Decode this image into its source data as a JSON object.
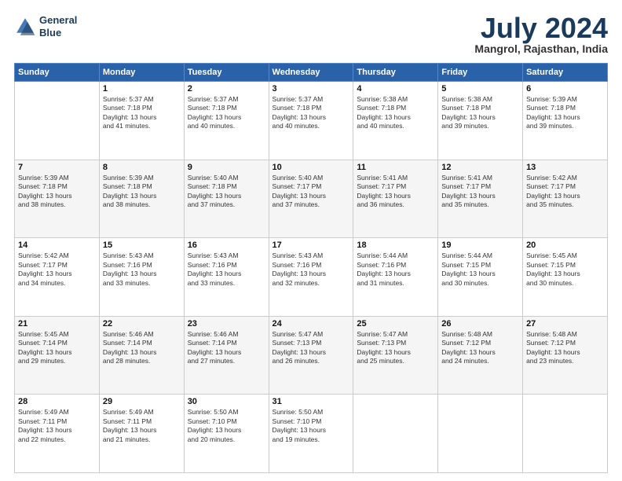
{
  "header": {
    "logo_line1": "General",
    "logo_line2": "Blue",
    "month": "July 2024",
    "location": "Mangrol, Rajasthan, India"
  },
  "days_of_week": [
    "Sunday",
    "Monday",
    "Tuesday",
    "Wednesday",
    "Thursday",
    "Friday",
    "Saturday"
  ],
  "weeks": [
    [
      {
        "day": "",
        "info": ""
      },
      {
        "day": "1",
        "info": "Sunrise: 5:37 AM\nSunset: 7:18 PM\nDaylight: 13 hours\nand 41 minutes."
      },
      {
        "day": "2",
        "info": "Sunrise: 5:37 AM\nSunset: 7:18 PM\nDaylight: 13 hours\nand 40 minutes."
      },
      {
        "day": "3",
        "info": "Sunrise: 5:37 AM\nSunset: 7:18 PM\nDaylight: 13 hours\nand 40 minutes."
      },
      {
        "day": "4",
        "info": "Sunrise: 5:38 AM\nSunset: 7:18 PM\nDaylight: 13 hours\nand 40 minutes."
      },
      {
        "day": "5",
        "info": "Sunrise: 5:38 AM\nSunset: 7:18 PM\nDaylight: 13 hours\nand 39 minutes."
      },
      {
        "day": "6",
        "info": "Sunrise: 5:39 AM\nSunset: 7:18 PM\nDaylight: 13 hours\nand 39 minutes."
      }
    ],
    [
      {
        "day": "7",
        "info": "Sunrise: 5:39 AM\nSunset: 7:18 PM\nDaylight: 13 hours\nand 38 minutes."
      },
      {
        "day": "8",
        "info": "Sunrise: 5:39 AM\nSunset: 7:18 PM\nDaylight: 13 hours\nand 38 minutes."
      },
      {
        "day": "9",
        "info": "Sunrise: 5:40 AM\nSunset: 7:18 PM\nDaylight: 13 hours\nand 37 minutes."
      },
      {
        "day": "10",
        "info": "Sunrise: 5:40 AM\nSunset: 7:17 PM\nDaylight: 13 hours\nand 37 minutes."
      },
      {
        "day": "11",
        "info": "Sunrise: 5:41 AM\nSunset: 7:17 PM\nDaylight: 13 hours\nand 36 minutes."
      },
      {
        "day": "12",
        "info": "Sunrise: 5:41 AM\nSunset: 7:17 PM\nDaylight: 13 hours\nand 35 minutes."
      },
      {
        "day": "13",
        "info": "Sunrise: 5:42 AM\nSunset: 7:17 PM\nDaylight: 13 hours\nand 35 minutes."
      }
    ],
    [
      {
        "day": "14",
        "info": "Sunrise: 5:42 AM\nSunset: 7:17 PM\nDaylight: 13 hours\nand 34 minutes."
      },
      {
        "day": "15",
        "info": "Sunrise: 5:43 AM\nSunset: 7:16 PM\nDaylight: 13 hours\nand 33 minutes."
      },
      {
        "day": "16",
        "info": "Sunrise: 5:43 AM\nSunset: 7:16 PM\nDaylight: 13 hours\nand 33 minutes."
      },
      {
        "day": "17",
        "info": "Sunrise: 5:43 AM\nSunset: 7:16 PM\nDaylight: 13 hours\nand 32 minutes."
      },
      {
        "day": "18",
        "info": "Sunrise: 5:44 AM\nSunset: 7:16 PM\nDaylight: 13 hours\nand 31 minutes."
      },
      {
        "day": "19",
        "info": "Sunrise: 5:44 AM\nSunset: 7:15 PM\nDaylight: 13 hours\nand 30 minutes."
      },
      {
        "day": "20",
        "info": "Sunrise: 5:45 AM\nSunset: 7:15 PM\nDaylight: 13 hours\nand 30 minutes."
      }
    ],
    [
      {
        "day": "21",
        "info": "Sunrise: 5:45 AM\nSunset: 7:14 PM\nDaylight: 13 hours\nand 29 minutes."
      },
      {
        "day": "22",
        "info": "Sunrise: 5:46 AM\nSunset: 7:14 PM\nDaylight: 13 hours\nand 28 minutes."
      },
      {
        "day": "23",
        "info": "Sunrise: 5:46 AM\nSunset: 7:14 PM\nDaylight: 13 hours\nand 27 minutes."
      },
      {
        "day": "24",
        "info": "Sunrise: 5:47 AM\nSunset: 7:13 PM\nDaylight: 13 hours\nand 26 minutes."
      },
      {
        "day": "25",
        "info": "Sunrise: 5:47 AM\nSunset: 7:13 PM\nDaylight: 13 hours\nand 25 minutes."
      },
      {
        "day": "26",
        "info": "Sunrise: 5:48 AM\nSunset: 7:12 PM\nDaylight: 13 hours\nand 24 minutes."
      },
      {
        "day": "27",
        "info": "Sunrise: 5:48 AM\nSunset: 7:12 PM\nDaylight: 13 hours\nand 23 minutes."
      }
    ],
    [
      {
        "day": "28",
        "info": "Sunrise: 5:49 AM\nSunset: 7:11 PM\nDaylight: 13 hours\nand 22 minutes."
      },
      {
        "day": "29",
        "info": "Sunrise: 5:49 AM\nSunset: 7:11 PM\nDaylight: 13 hours\nand 21 minutes."
      },
      {
        "day": "30",
        "info": "Sunrise: 5:50 AM\nSunset: 7:10 PM\nDaylight: 13 hours\nand 20 minutes."
      },
      {
        "day": "31",
        "info": "Sunrise: 5:50 AM\nSunset: 7:10 PM\nDaylight: 13 hours\nand 19 minutes."
      },
      {
        "day": "",
        "info": ""
      },
      {
        "day": "",
        "info": ""
      },
      {
        "day": "",
        "info": ""
      }
    ]
  ]
}
